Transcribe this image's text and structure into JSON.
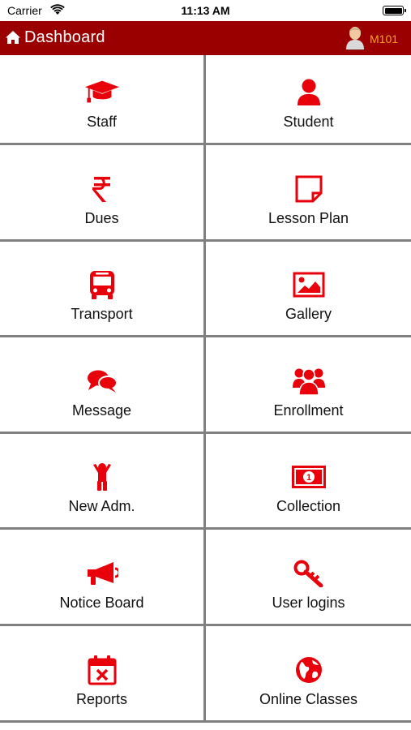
{
  "status_bar": {
    "carrier": "Carrier",
    "time": "11:13 AM"
  },
  "header": {
    "title": "Dashboard",
    "user_code": "M101"
  },
  "tiles": [
    {
      "label": "Staff",
      "icon": "graduation-cap-icon"
    },
    {
      "label": "Student",
      "icon": "user-icon"
    },
    {
      "label": "Dues",
      "icon": "rupee-icon"
    },
    {
      "label": "Lesson Plan",
      "icon": "note-page-icon"
    },
    {
      "label": "Transport",
      "icon": "bus-icon"
    },
    {
      "label": "Gallery",
      "icon": "picture-icon"
    },
    {
      "label": "Message",
      "icon": "chat-bubbles-icon"
    },
    {
      "label": "Enrollment",
      "icon": "users-group-icon"
    },
    {
      "label": "New Adm.",
      "icon": "child-icon"
    },
    {
      "label": "Collection",
      "icon": "banknote-icon"
    },
    {
      "label": "Notice Board",
      "icon": "megaphone-icon"
    },
    {
      "label": "User logins",
      "icon": "key-icon"
    },
    {
      "label": "Reports",
      "icon": "calendar-x-icon"
    },
    {
      "label": "Online Classes",
      "icon": "globe-icon"
    }
  ],
  "colors": {
    "header_bg": "#9a0000",
    "icon_red": "#e8000b",
    "user_code": "#f2a51a",
    "divider": "#808080"
  }
}
